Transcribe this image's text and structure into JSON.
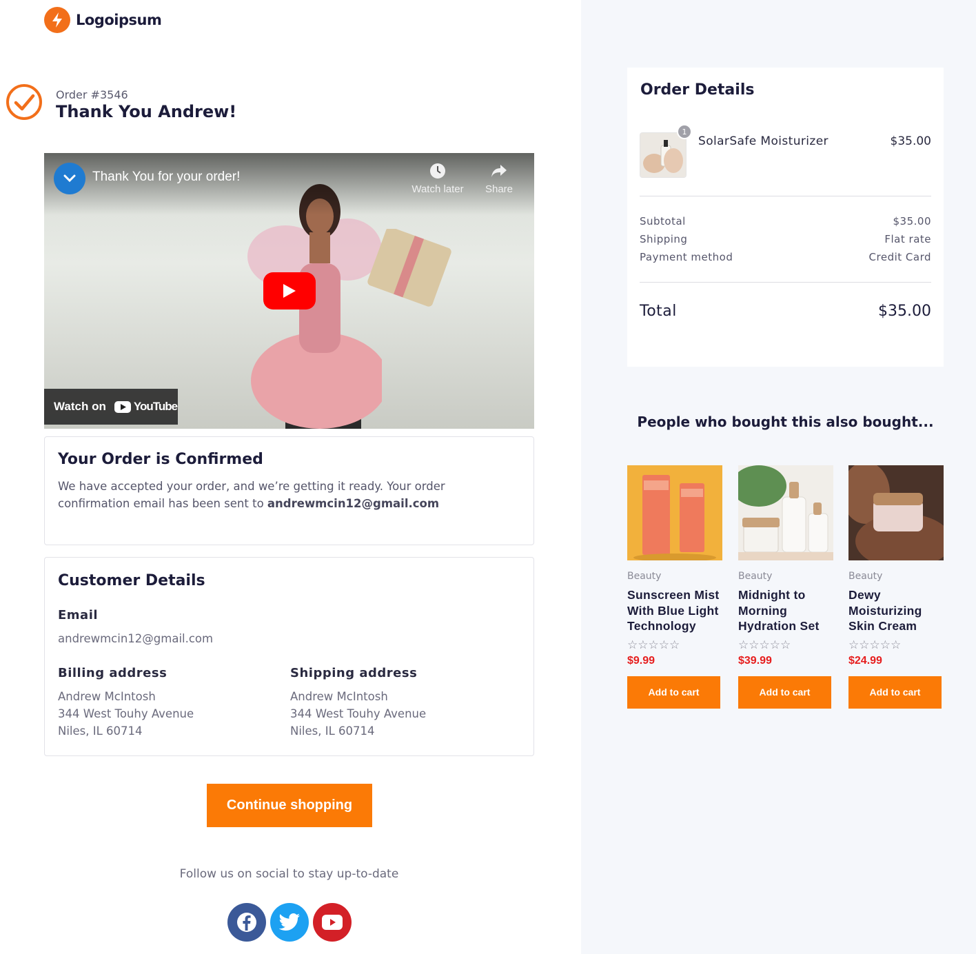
{
  "brand": {
    "name": "Logoipsum",
    "accent": "#fb7a06"
  },
  "order": {
    "number": "Order #3546",
    "thanks": "Thank You Andrew!"
  },
  "video": {
    "title": "Thank You for your order!",
    "watch_later": "Watch later",
    "share": "Share",
    "watch_on": "Watch on",
    "youtube": "YouTube"
  },
  "confirmed": {
    "heading": "Your Order is Confirmed",
    "text": "We have accepted your order, and we’re getting it ready. Your order confirmation email has been sent to ",
    "email": "andrewmcin12@gmail.com"
  },
  "customer": {
    "heading": "Customer Details",
    "email_label": "Email",
    "email": "andrewmcin12@gmail.com",
    "billing_label": "Billing address",
    "billing": [
      "Andrew McIntosh",
      "344 West Touhy Avenue",
      "Niles, IL 60714"
    ],
    "shipping_label": "Shipping address",
    "shipping": [
      "Andrew McIntosh",
      "344 West Touhy Avenue",
      "Niles, IL 60714"
    ]
  },
  "continue_label": "Continue shopping",
  "follow_text": "Follow us on social to stay up-to-date",
  "social": [
    "facebook-icon",
    "twitter-icon",
    "youtube-icon"
  ],
  "order_details": {
    "heading": "Order Details",
    "item": {
      "name": "SolarSafe Moisturizer",
      "price": "$35.00",
      "qty": "1"
    },
    "rows": [
      {
        "label": "Subtotal",
        "value": "$35.00"
      },
      {
        "label": "Shipping",
        "value": "Flat rate"
      },
      {
        "label": "Payment method",
        "value": "Credit Card"
      }
    ],
    "total_label": "Total",
    "total_value": "$35.00"
  },
  "also_bought": {
    "heading": "People who bought this also bought...",
    "products": [
      {
        "category": "Beauty",
        "name": "Sunscreen Mist With Blue Light Technology",
        "price": "$9.99",
        "rating": 0,
        "cta": "Add to cart"
      },
      {
        "category": "Beauty",
        "name": "Midnight to Morning Hydration Set",
        "price": "$39.99",
        "rating": 0,
        "cta": "Add to cart"
      },
      {
        "category": "Beauty",
        "name": "Dewy Moisturizing Skin Cream",
        "price": "$24.99",
        "rating": 0,
        "cta": "Add to cart"
      }
    ]
  }
}
